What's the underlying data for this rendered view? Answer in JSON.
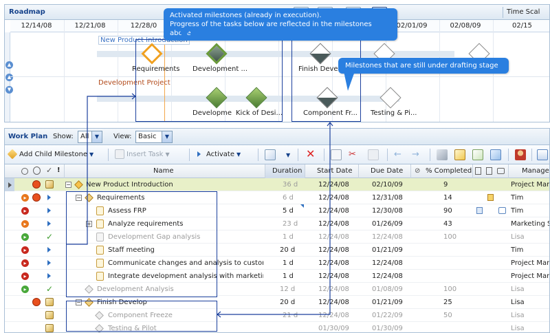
{
  "roadmap": {
    "title": "Roadmap",
    "time_scale_label": "Time Scal",
    "dates": [
      "12/14/08",
      "12/21/08",
      "12/28/0",
      "",
      "",
      "",
      "",
      "02/01/09",
      "02/08/09",
      "02/15"
    ],
    "projects": [
      {
        "label": "New Product Introduction"
      },
      {
        "label": "Development Project"
      }
    ],
    "milestones_top": [
      {
        "label": "Requirements",
        "style": "orange"
      },
      {
        "label": "Development ...",
        "style": "green-dark"
      },
      {
        "label": "Finish Develo",
        "style": "half"
      },
      {
        "label": "",
        "style": "gray"
      },
      {
        "label": "",
        "style": "gray"
      }
    ],
    "milestones_bottom": [
      {
        "label": "Developme",
        "style": "green"
      },
      {
        "label": "Kick of Desi...",
        "style": "green"
      },
      {
        "label": "Component Fr...",
        "style": "half"
      },
      {
        "label": "Testing & Pi...",
        "style": "gray"
      }
    ]
  },
  "callouts": {
    "activated": [
      "Activated milestones (already in execution).",
      "Progress of the tasks below are reflected in the milestones above"
    ],
    "drafting": "Milestones that are still under drafting stage"
  },
  "workplan": {
    "title": "Work Plan",
    "show_label": "Show:",
    "show_value": "All",
    "view_label": "View:",
    "view_value": "Basic",
    "toolbar": {
      "add_child_milestone": "Add Child Milestone",
      "insert_task": "Insert Task",
      "activate": "Activate"
    },
    "columns": {
      "name": "Name",
      "duration": "Duration",
      "start_date": "Start Date",
      "due_date": "Due Date",
      "percent_completed": "% Completed",
      "manager": "Manager"
    },
    "rows": [
      {
        "name": "New Product Introduction",
        "duration": "36 d",
        "start": "12/24/08",
        "due": "02/10/09",
        "pct": "9",
        "manager": "Project Mana"
      },
      {
        "name": "Requirements",
        "duration": "6 d",
        "start": "12/24/08",
        "due": "12/31/08",
        "pct": "14",
        "manager": "Tim"
      },
      {
        "name": "Assess FRP",
        "duration": "5 d",
        "start": "12/24/08",
        "due": "12/30/08",
        "pct": "90",
        "manager": "Tim"
      },
      {
        "name": "Analyze requirements",
        "duration": "23 d",
        "start": "12/24/08",
        "due": "01/26/09",
        "pct": "43",
        "manager": "Marketing St"
      },
      {
        "name": "Development Gap analysis",
        "duration": "1 d",
        "start": "12/24/08",
        "due": "12/24/08",
        "pct": "100",
        "manager": "Lisa"
      },
      {
        "name": "Staff meeting",
        "duration": "20 d",
        "start": "12/24/08",
        "due": "01/21/09",
        "pct": "",
        "manager": "Tim"
      },
      {
        "name": "Communicate changes and analysis to custome",
        "duration": "1 d",
        "start": "12/24/08",
        "due": "12/24/08",
        "pct": "",
        "manager": "Project Mana"
      },
      {
        "name": "Integrate development analysis with marketing",
        "duration": "1 d",
        "start": "12/24/08",
        "due": "12/24/08",
        "pct": "",
        "manager": "Project Mana"
      },
      {
        "name": "Development Analysis",
        "duration": "12 d",
        "start": "12/24/08",
        "due": "01/08/09",
        "pct": "100",
        "manager": "Lisa"
      },
      {
        "name": "Finish Develop",
        "duration": "20 d",
        "start": "12/24/08",
        "due": "01/21/09",
        "pct": "25",
        "manager": "Lisa"
      },
      {
        "name": "Component Freeze",
        "duration": "21 d",
        "start": "12/24/08",
        "due": "01/22/09",
        "pct": "50",
        "manager": "Lisa"
      },
      {
        "name": "Testing & Pilot",
        "duration": "",
        "start": "01/30/09",
        "due": "01/30/09",
        "pct": "",
        "manager": "Lisa"
      }
    ]
  }
}
